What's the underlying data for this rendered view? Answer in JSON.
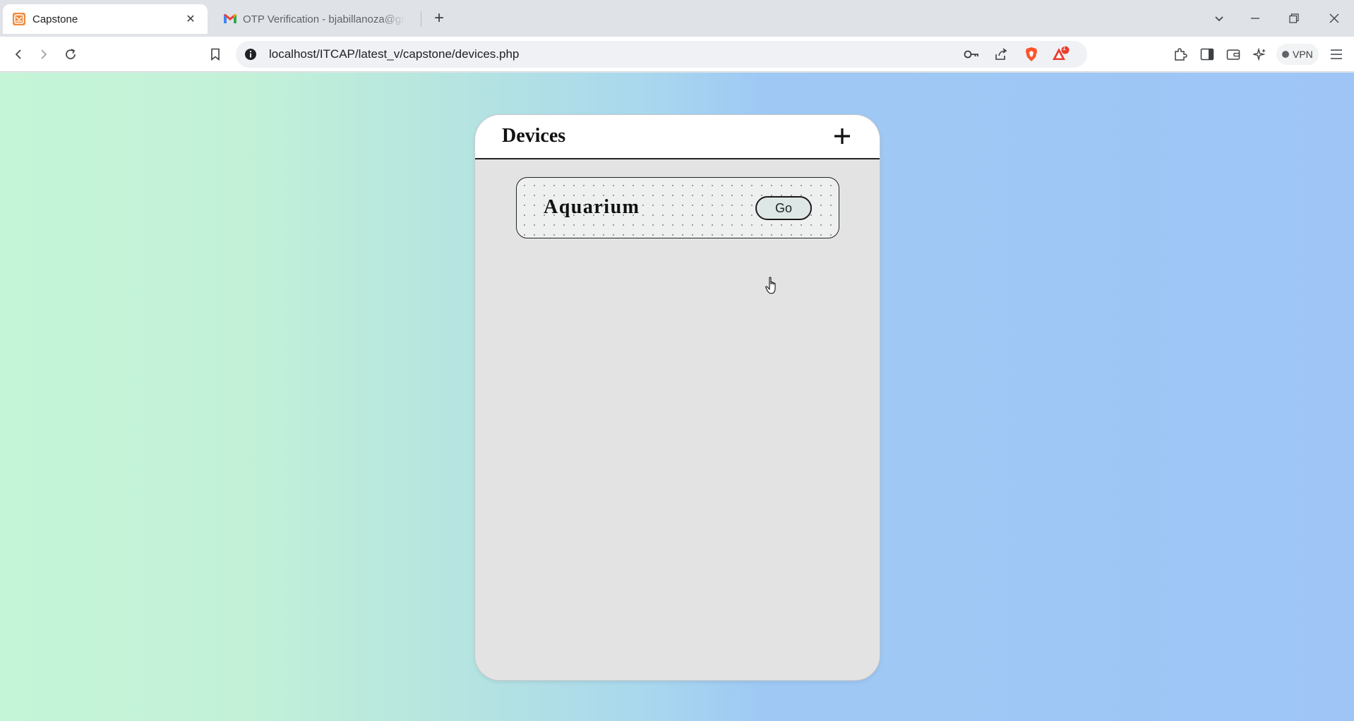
{
  "browser": {
    "tabs": [
      {
        "title": "Capstone",
        "active": true,
        "favicon": "capstone-favicon"
      },
      {
        "title": "OTP Verification - bjabillanoza@gm",
        "active": false,
        "favicon": "gmail-favicon"
      }
    ],
    "address_bar": {
      "url": "localhost/ITCAP/latest_v/capstone/devices.php"
    },
    "extensions_badge": "1",
    "vpn_label": "VPN",
    "colors": {
      "tabstrip": "#dfe2e7",
      "brave_orange": "#fb542b",
      "rewards_red": "#ea3d2f"
    }
  },
  "page": {
    "header": {
      "title": "Devices",
      "add_icon": "plus-icon"
    },
    "devices": [
      {
        "name": "Aquarium",
        "button_label": "Go"
      }
    ],
    "colors": {
      "gradient_left": "#c5f5d7",
      "gradient_right": "#9ec5f6",
      "card_bg": "#e3e3e3"
    }
  }
}
